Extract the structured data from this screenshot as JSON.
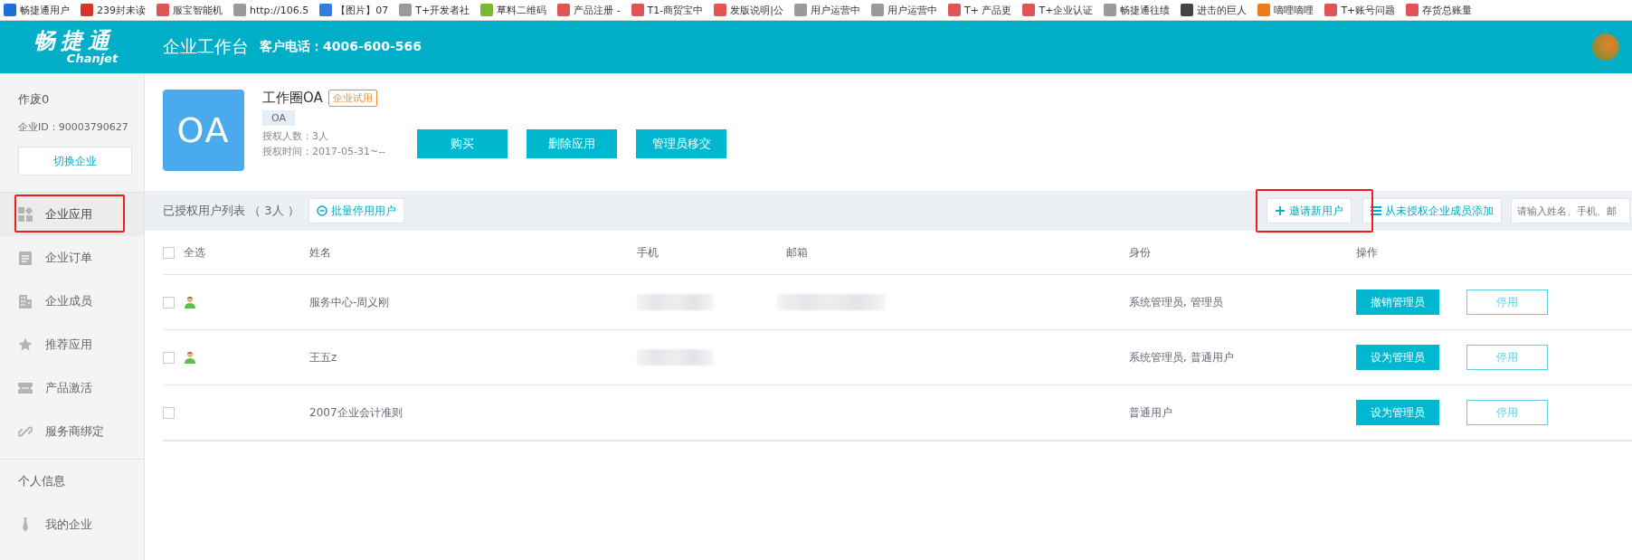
{
  "bookmarks": [
    {
      "label": "畅捷通用户",
      "color": "#1e6fd9"
    },
    {
      "label": "239封未读",
      "color": "#d9342b"
    },
    {
      "label": "服宝智能机",
      "color": "#e05454"
    },
    {
      "label": "http://106.5",
      "color": "#9a9a9a"
    },
    {
      "label": "【图片】07",
      "color": "#2f7de1"
    },
    {
      "label": "T+开发者社",
      "color": "#9a9a9a"
    },
    {
      "label": "草料二维码",
      "color": "#7cb82f"
    },
    {
      "label": "产品注册 -",
      "color": "#e05454"
    },
    {
      "label": "T1-商贸宝中",
      "color": "#e05454"
    },
    {
      "label": "发版说明|公",
      "color": "#e05454"
    },
    {
      "label": "用户运营中",
      "color": "#9a9a9a"
    },
    {
      "label": "用户运营中",
      "color": "#9a9a9a"
    },
    {
      "label": "T+ 产品更",
      "color": "#e05454"
    },
    {
      "label": "T+企业认证",
      "color": "#e05454"
    },
    {
      "label": "畅捷通往绩",
      "color": "#9a9a9a"
    },
    {
      "label": "进击的巨人",
      "color": "#444444"
    },
    {
      "label": "嘀哩嘀哩",
      "color": "#f07a1a"
    },
    {
      "label": "T+账号问题",
      "color": "#e05454"
    },
    {
      "label": "存货总账量",
      "color": "#e05454"
    }
  ],
  "header": {
    "logo_cn": "畅捷通",
    "logo_en": "Chanjet",
    "title": "企业工作台",
    "phone": "客户电话：4006-600-566"
  },
  "sidebar": {
    "company": "作废0",
    "company_id": "企业ID：90003790627",
    "switch_button": "切换企业",
    "items": [
      {
        "label": "企业应用",
        "kind": "apps",
        "selected": true,
        "highlighted": true
      },
      {
        "label": "企业订单",
        "kind": "order",
        "selected": false,
        "highlighted": false
      },
      {
        "label": "企业成员",
        "kind": "building",
        "selected": false,
        "highlighted": false
      },
      {
        "label": "推荐应用",
        "kind": "star",
        "selected": false,
        "highlighted": false
      },
      {
        "label": "产品激活",
        "kind": "ticket",
        "selected": false,
        "highlighted": false
      },
      {
        "label": "服务商绑定",
        "kind": "link",
        "selected": false,
        "highlighted": false
      }
    ],
    "section": "个人信息",
    "personal_items": [
      {
        "label": "我的企业",
        "kind": "tie",
        "selected": false
      }
    ]
  },
  "app": {
    "icon_text": "OA",
    "name": "工作圈OA",
    "badge": "企业试用",
    "tag": "OA",
    "users": "授权人数：3人",
    "period": "授权时间：2017-05-31~--",
    "buttons": [
      "购买",
      "删除应用",
      "管理员移交"
    ]
  },
  "toolbar": {
    "title": "已授权用户列表 （ 3人 ）",
    "batch_button": "批量停用用户",
    "invite_button": "邀请新用户",
    "invite_highlighted": true,
    "add_button": "从未授权企业成员添加",
    "search_placeholder": "请输入姓名、手机、邮"
  },
  "table": {
    "select_all_checked": false,
    "columns": [
      "全选",
      "姓名",
      "手机",
      "邮箱",
      "身份",
      "操作"
    ],
    "rows": [
      {
        "checked": false,
        "has_avatar": true,
        "name": "服务中心-周义刚",
        "phone_blurred": true,
        "email_blurred": true,
        "role": "系统管理员, 管理员",
        "admin_button": "撤销管理员",
        "disable_button": "停用"
      },
      {
        "checked": false,
        "has_avatar": true,
        "name": "王五z",
        "phone_blurred": true,
        "email_blurred": false,
        "role": "系统管理员, 普通用户",
        "admin_button": "设为管理员",
        "disable_button": "停用"
      },
      {
        "checked": false,
        "has_avatar": false,
        "name": "2007企业会计准则",
        "phone_blurred": false,
        "email_blurred": false,
        "role": "普通用户",
        "admin_button": "设为管理员",
        "disable_button": "停用"
      }
    ]
  }
}
